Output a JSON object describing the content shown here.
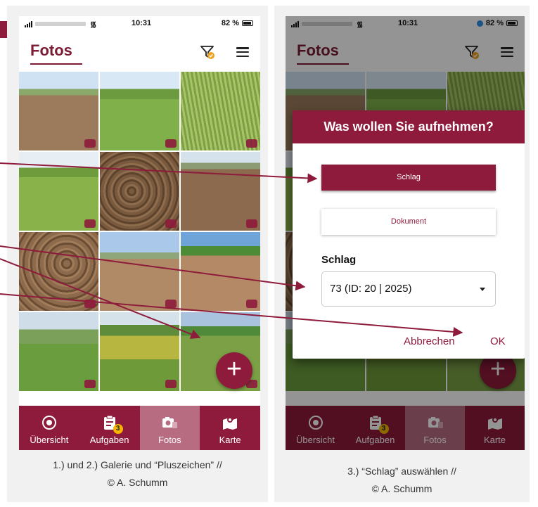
{
  "colors": {
    "brand": "#8e1b3c",
    "brand_light": "#b86c82",
    "badge": "#f5b400",
    "background": "#f1f1f1"
  },
  "left_screen": {
    "status": {
      "time": "10:31",
      "battery": "82 %"
    },
    "title": "Fotos",
    "icons": {
      "filter": "filter-check-icon",
      "menu": "hamburger-menu-icon"
    },
    "photo_count": 12,
    "fab_label": "+",
    "nav": [
      {
        "label": "Übersicht",
        "icon": "overview-icon"
      },
      {
        "label": "Aufgaben",
        "icon": "tasks-clipboard-icon",
        "badge": "3"
      },
      {
        "label": "Fotos",
        "icon": "camera-icon",
        "active": true
      },
      {
        "label": "Karte",
        "icon": "map-pin-icon"
      }
    ],
    "caption_line1": "1.) und 2.) Galerie und “Pluszeichen” //",
    "caption_line2": "© A. Schumm"
  },
  "right_screen": {
    "status": {
      "time": "10:31",
      "battery": "82 %"
    },
    "title": "Fotos",
    "fab_label": "+",
    "nav": [
      {
        "label": "Übersicht"
      },
      {
        "label": "Aufgaben",
        "badge": "3"
      },
      {
        "label": "Fotos",
        "active": true
      },
      {
        "label": "Karte"
      }
    ],
    "dialog": {
      "title": "Was wollen Sie aufnehmen?",
      "option_primary": "Schlag",
      "option_secondary": "Dokument",
      "field_label": "Schlag",
      "select_value": "73 (ID: 20 | 2025)",
      "cancel": "Abbrechen",
      "ok": "OK"
    },
    "caption_line1": "3.) “Schlag” auswählen //",
    "caption_line2": "© A. Schumm"
  }
}
